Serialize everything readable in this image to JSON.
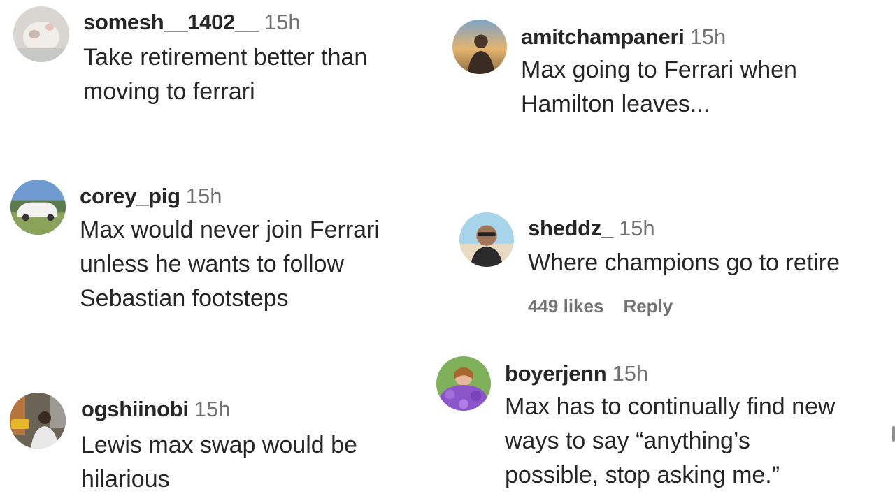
{
  "comments": [
    {
      "username": "somesh__1402__",
      "time": "15h",
      "lines": [
        "Take retirement better than",
        "moving to ferrari"
      ],
      "avatar": "avatar-photo"
    },
    {
      "username": "amitchampaneri",
      "time": "15h",
      "lines": [
        "Max going to Ferrari when",
        "Hamilton leaves..."
      ],
      "avatar": "avatar-photo"
    },
    {
      "username": "corey_pig",
      "time": "15h",
      "lines": [
        "Max would never join Ferrari",
        "unless he wants to follow",
        "Sebastian footsteps"
      ],
      "avatar": "avatar-photo"
    },
    {
      "username": "sheddz_",
      "time": "15h",
      "lines": [
        "Where champions go to retire"
      ],
      "likes": "449 likes",
      "reply": "Reply",
      "avatar": "avatar-photo"
    },
    {
      "username": "ogshiinobi",
      "time": "15h",
      "lines": [
        "Lewis max swap would be",
        "hilarious"
      ],
      "avatar": "avatar-photo"
    },
    {
      "username": "boyerjenn",
      "time": "15h",
      "lines": [
        "Max has to continually find new",
        "ways to say “anything’s",
        "possible, stop asking me.”"
      ],
      "avatar": "avatar-photo"
    }
  ]
}
